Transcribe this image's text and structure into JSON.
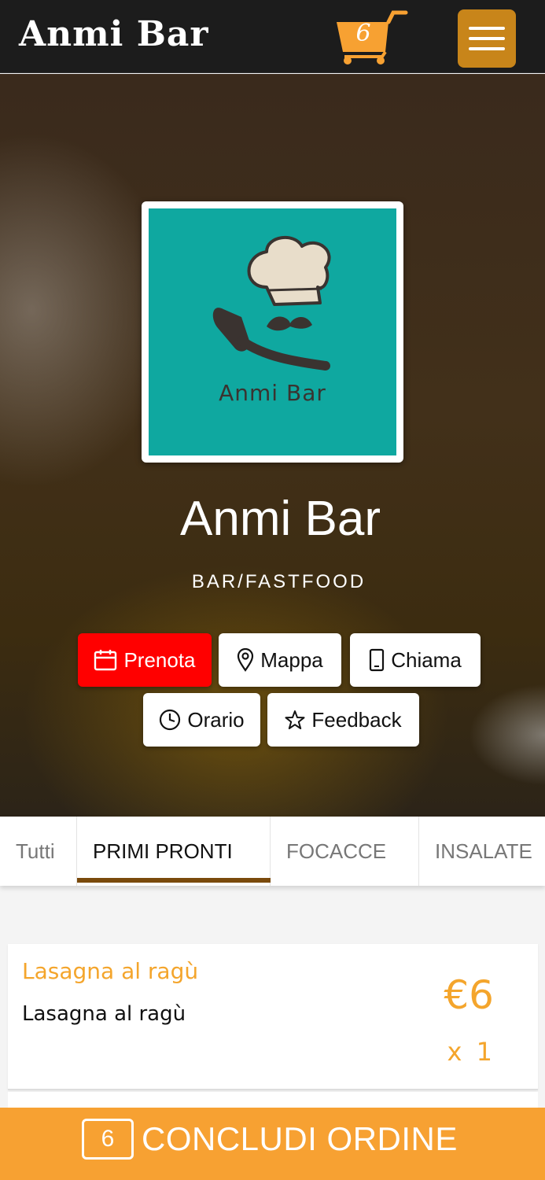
{
  "header": {
    "brand": "Anmi Bar",
    "cart_count": "6",
    "cart_icon": "shopping-cart-icon",
    "menu_icon": "hamburger-menu-icon"
  },
  "hero": {
    "logo_text": "Anmi Bar",
    "title": "Anmi Bar",
    "subtitle": "BAR/FASTFOOD",
    "buttons": {
      "prenota": "Prenota",
      "mappa": "Mappa",
      "chiama": "Chiama",
      "orario": "Orario",
      "feedback": "Feedback"
    }
  },
  "tabs": [
    "Tutti",
    "PRIMI PRONTI",
    "FOCACCE",
    "INSALATE"
  ],
  "active_tab": "PRIMI PRONTI",
  "items": [
    {
      "name": "Lasagna al ragù",
      "description": "Lasagna al ragù",
      "price": "€6",
      "quantity": "x 1"
    }
  ],
  "order": {
    "count": "6",
    "label": "CONCLUDI ORDINE"
  },
  "colors": {
    "accent": "#f7a132",
    "brown": "#c8851a",
    "teal": "#0fa8a0",
    "red": "#ff0000"
  }
}
